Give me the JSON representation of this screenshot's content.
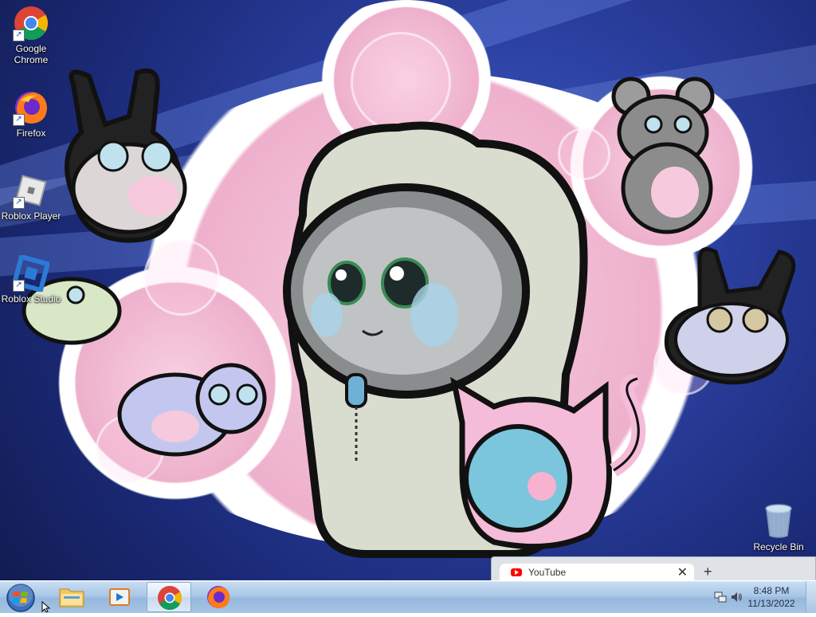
{
  "desktop": {
    "icons": [
      {
        "label": "Google\nChrome",
        "icon": "chrome-icon"
      },
      {
        "label": "Firefox",
        "icon": "firefox-icon"
      },
      {
        "label": "Roblox Player",
        "icon": "roblox-player-icon"
      },
      {
        "label": "Roblox Studio",
        "icon": "roblox-studio-icon"
      }
    ],
    "recycle_bin": {
      "label": "Recycle Bin",
      "icon": "recycle-bin-icon"
    }
  },
  "chrome_popup": {
    "tab_title": "YouTube",
    "tab_icon": "youtube-icon",
    "close_glyph": "✕",
    "new_tab_glyph": "+"
  },
  "taskbar": {
    "start": {
      "icon": "windows-logo-icon"
    },
    "pinned": [
      {
        "name": "file-explorer",
        "icon": "folder-icon",
        "active": false
      },
      {
        "name": "media-player",
        "icon": "media-player-icon",
        "active": false
      },
      {
        "name": "google-chrome",
        "icon": "chrome-icon",
        "active": true
      },
      {
        "name": "firefox",
        "icon": "firefox-icon",
        "active": false
      }
    ],
    "tray": {
      "network_icon": "network-icon",
      "volume_icon": "speaker-icon"
    },
    "clock": {
      "time": "8:48 PM",
      "date": "11/13/2022"
    }
  },
  "colors": {
    "taskbar_top": "#c9def2",
    "desktop_blue": "#2a3f9e",
    "bubble_pink": "#eeb0cc"
  }
}
